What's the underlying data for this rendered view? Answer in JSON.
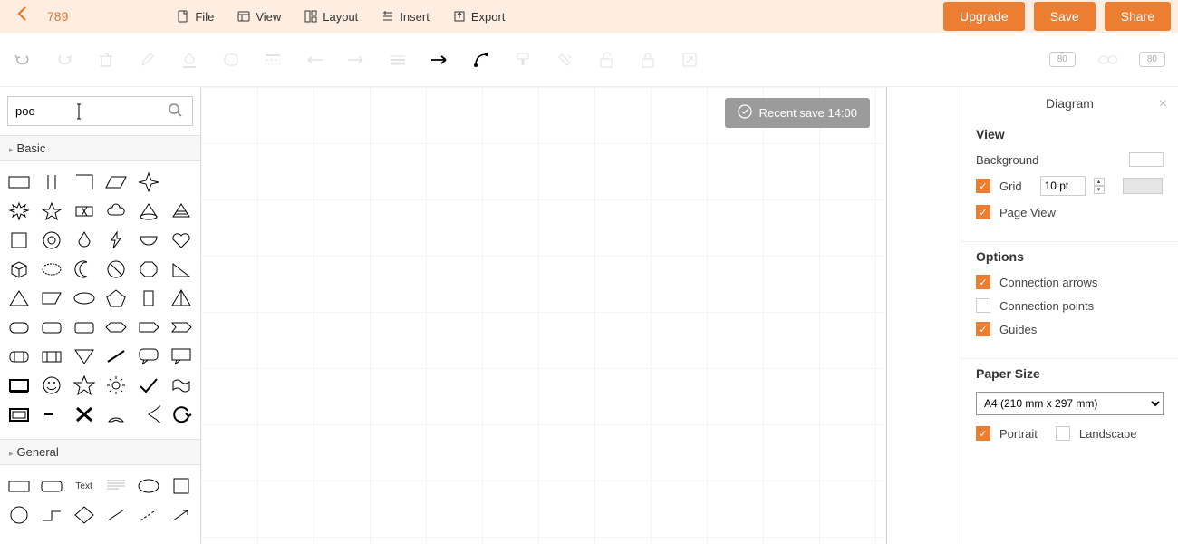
{
  "header": {
    "doc_title": "789",
    "menu": {
      "file": "File",
      "view": "View",
      "layout": "Layout",
      "insert": "Insert",
      "export": "Export"
    },
    "buttons": {
      "upgrade": "Upgrade",
      "save": "Save",
      "share": "Share"
    }
  },
  "toolbar": {
    "link1": "80",
    "link2": "80"
  },
  "left": {
    "search_value": "poo",
    "cat_basic": "Basic",
    "cat_general": "General",
    "general_text": "Text"
  },
  "canvas": {
    "toast": "Recent save 14:00"
  },
  "right": {
    "panel_title": "Diagram",
    "view_section": "View",
    "background_label": "Background",
    "grid_label": "Grid",
    "grid_value": "10 pt",
    "pageview_label": "Page View",
    "options_section": "Options",
    "conn_arrows": "Connection arrows",
    "conn_points": "Connection points",
    "guides": "Guides",
    "paper_section": "Paper Size",
    "paper_option": "A4 (210 mm x 297 mm)",
    "portrait": "Portrait",
    "landscape": "Landscape"
  }
}
